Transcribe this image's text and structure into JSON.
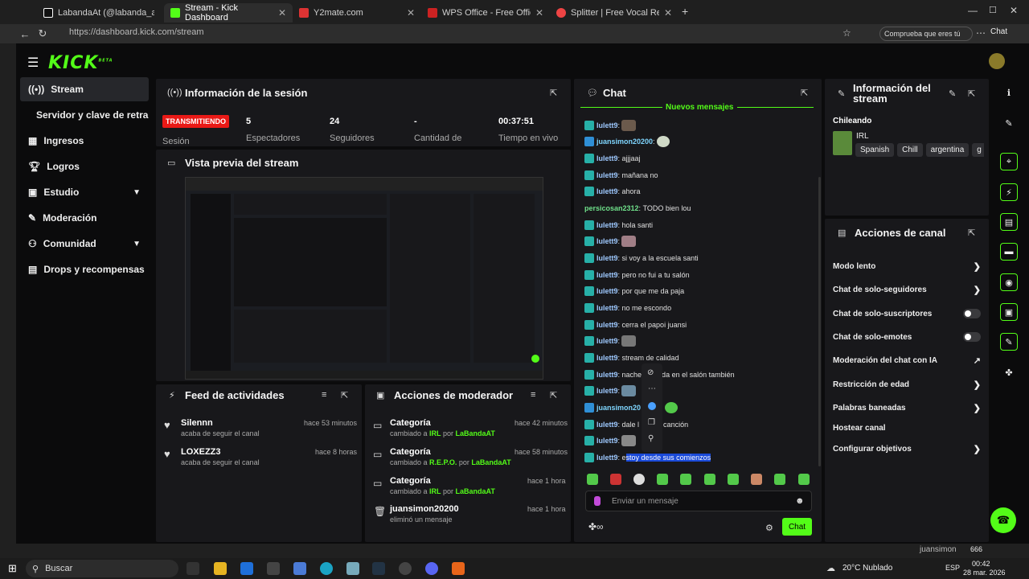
{
  "browser": {
    "tabs": [
      {
        "title": "LabandaAt (@labanda_at) | TikTok",
        "active": false
      },
      {
        "title": "Stream - Kick Dashboard",
        "active": true
      },
      {
        "title": "Y2mate.com",
        "active": false
      },
      {
        "title": "WPS Office - Free Office Downloa",
        "active": false
      },
      {
        "title": "Splitter | Free Vocal Remover Tool",
        "active": false
      }
    ],
    "url": "https://dashboard.kick.com/stream",
    "promo": "Comprueba que eres tú",
    "chat_button": "Chat"
  },
  "app": {
    "logo": "KICK",
    "logo_sup": "BETA"
  },
  "sidebar": {
    "items": [
      {
        "label": "Stream",
        "icon": "broadcast-icon"
      },
      {
        "label": "Servidor y clave de retransn",
        "icon": ""
      },
      {
        "label": "Ingresos",
        "icon": "revenue-icon"
      },
      {
        "label": "Logros",
        "icon": "trophy-icon"
      },
      {
        "label": "Estudio",
        "icon": "studio-icon",
        "chevron": "⌄"
      },
      {
        "label": "Moderación",
        "icon": "wrench-icon"
      },
      {
        "label": "Comunidad",
        "icon": "people-icon",
        "chevron": "⌄"
      },
      {
        "label": "Drops y recompensas",
        "icon": "gift-icon"
      }
    ]
  },
  "session": {
    "title": "Información de la sesión",
    "status": "TRANSMITIENDO",
    "status_label": "Sesión",
    "stats": [
      {
        "value": "5",
        "label": "Espectadores"
      },
      {
        "value": "24",
        "label": "Seguidores"
      },
      {
        "value": "-",
        "label": "Cantidad de"
      },
      {
        "value": "00:37:51",
        "label": "Tiempo en vivo"
      }
    ]
  },
  "preview": {
    "title": "Vista previa del stream"
  },
  "feed": {
    "title": "Feed de actividades",
    "items": [
      {
        "name": "Silennn",
        "text": "acaba de seguir el canal",
        "time": "hace 53 minutos"
      },
      {
        "name": "LOXEZZ3",
        "text": "acaba de seguir el canal",
        "time": "hace 8 horas"
      }
    ]
  },
  "moderator": {
    "title": "Acciones de moderador",
    "items": [
      {
        "title": "Categoría",
        "pre": "cambiado a ",
        "value": "IRL",
        "mid": " por ",
        "by": "LaBandaAT",
        "time": "hace 42 minutos"
      },
      {
        "title": "Categoría",
        "pre": "cambiado a ",
        "value": "R.E.P.O.",
        "mid": " por ",
        "by": "LaBandaAT",
        "time": "hace 58 minutos"
      },
      {
        "title": "Categoría",
        "pre": "cambiado a ",
        "value": "IRL",
        "mid": " por ",
        "by": "LaBandaAT",
        "time": "hace 1 hora"
      },
      {
        "title": "juansimon20200",
        "pre": "eliminó un mensaje",
        "value": "",
        "mid": "",
        "by": "",
        "time": "hace 1 hora"
      }
    ]
  },
  "chat": {
    "title": "Chat",
    "new_messages": "Nuevos mensajes",
    "messages": [
      {
        "user": "lulett9",
        "text": "",
        "emote": true
      },
      {
        "user": "juansimon20200",
        "text": "",
        "emote": true
      },
      {
        "user": "lulett9",
        "text": "ajjjaaj"
      },
      {
        "user": "lulett9",
        "text": "mañana no"
      },
      {
        "user": "lulett9",
        "text": "ahora"
      },
      {
        "user": "persicosan2312",
        "text": "TODO bien lou"
      },
      {
        "user": "lulett9",
        "text": "hola santi"
      },
      {
        "user": "lulett9",
        "text": "",
        "emote": true
      },
      {
        "user": "lulett9",
        "text": "si voy a la escuela santi"
      },
      {
        "user": "lulett9",
        "text": "pero no fui a tu salón"
      },
      {
        "user": "lulett9",
        "text": "por que me da paja"
      },
      {
        "user": "lulett9",
        "text": "no me escondo"
      },
      {
        "user": "lulett9",
        "text": "cerra el papoi juansi"
      },
      {
        "user": "lulett9",
        "text": "",
        "emote": true
      },
      {
        "user": "lulett9",
        "text": "stream de calidad"
      },
      {
        "user": "lulett9",
        "text": "nache        eda en el salón también"
      },
      {
        "user": "lulett9",
        "text": "",
        "emote": true
      },
      {
        "user": "juansimon20",
        "text": "",
        "emote": true
      },
      {
        "user": "lulett9",
        "text": "dale l         a canción"
      },
      {
        "user": "lulett9",
        "text": "",
        "emote": true
      },
      {
        "user": "lulett9",
        "text_pre": "e",
        "text_sel": "stoy desde sus comienzos"
      }
    ],
    "input_placeholder": "Enviar un mensaje",
    "send_label": "Chat"
  },
  "stream_info": {
    "title": "Información del stream",
    "stream_title": "Chileando",
    "category": "IRL",
    "tags": [
      "Spanish",
      "Chill",
      "argentina",
      "g"
    ]
  },
  "channel_actions": {
    "title": "Acciones de canal",
    "items": [
      {
        "label": "Modo lento",
        "control": "arrow"
      },
      {
        "label": "Chat de solo-seguidores",
        "control": "arrow"
      },
      {
        "label": "Chat de solo-suscriptores",
        "control": "toggle"
      },
      {
        "label": "Chat de solo-emotes",
        "control": "toggle"
      },
      {
        "label": "Moderación del chat con IA",
        "control": "chart"
      },
      {
        "label": "Restricción de edad",
        "control": "arrow"
      },
      {
        "label": "Palabras baneadas",
        "control": "arrow"
      },
      {
        "label": "Hostear canal",
        "control": "none"
      },
      {
        "label": "Configurar objetivos",
        "control": "arrow"
      }
    ]
  },
  "taskbar": {
    "search": "Buscar",
    "weather": "20°C  Nublado",
    "lang": "ESP",
    "time": "00:42",
    "date": "28 mar. 2026",
    "viewer": "juansimon",
    "viewer_count": "666"
  }
}
